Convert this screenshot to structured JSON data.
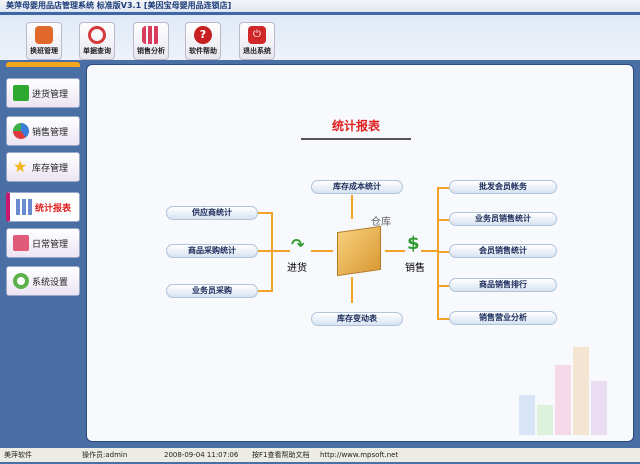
{
  "window": {
    "title": "美萍母婴用品店管理系统 标准版V3.1 [美因宝母婴用品连锁店]"
  },
  "toolbar": {
    "buttons": [
      {
        "label": "换班管理",
        "icon": "shift-icon",
        "color": "#e0682a"
      },
      {
        "label": "单据查询",
        "icon": "search-icon",
        "color": "#d63a3a"
      },
      {
        "label": "销售分析",
        "icon": "bar-chart-icon",
        "color": "#d83b5b"
      },
      {
        "label": "软件帮助",
        "icon": "help-icon",
        "color": "#c82020"
      },
      {
        "label": "退出系统",
        "icon": "power-icon",
        "color": "#d02828"
      }
    ]
  },
  "sidebar": {
    "items": [
      {
        "label": "进货管理",
        "icon": "plus-icon",
        "color": "#2fa82f"
      },
      {
        "label": "销售管理",
        "icon": "pie-icon",
        "color": "#3a7ad8"
      },
      {
        "label": "库存管理",
        "icon": "star-icon",
        "color": "#f3b51c"
      },
      {
        "label": "统计报表",
        "icon": "bar-chart-icon",
        "color": "#6a8ad0",
        "selected": true
      },
      {
        "label": "日常管理",
        "icon": "brush-icon",
        "color": "#e05a7a"
      },
      {
        "label": "系统设置",
        "icon": "gear-icon",
        "color": "#5ab04a"
      }
    ]
  },
  "main": {
    "title": "统计报表",
    "purchase_label": "进货",
    "warehouse_label": "仓库",
    "sales_label": "销售",
    "left_reports": [
      "供应商统计",
      "商品采购统计",
      "业务员采购"
    ],
    "top_report": "库存成本统计",
    "bottom_report": "库存变动表",
    "right_reports": [
      "批发会员帐务",
      "业务员销售统计",
      "会员销售统计",
      "商品销售排行",
      "销售营业分析"
    ]
  },
  "status": {
    "company": "美萍软件",
    "operator": "操作员:admin",
    "datetime": "2008-09-04 11:07:06",
    "help": "按F1查看帮助文档",
    "url": "http://www.mpsoft.net"
  }
}
